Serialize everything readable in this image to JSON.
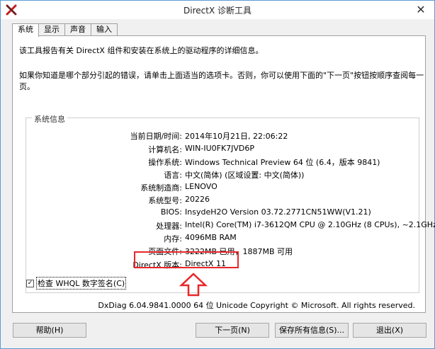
{
  "window": {
    "title": "DirectX 诊断工具"
  },
  "icons": {
    "app": "directx-x-icon",
    "close": "close-icon",
    "arrow": "up-arrow-icon",
    "check": "checkmark-icon"
  },
  "colors": {
    "highlight": "#e8262a",
    "window_border": "#5a9bd5"
  },
  "tabs": [
    {
      "label": "系统",
      "active": true
    },
    {
      "label": "显示",
      "active": false
    },
    {
      "label": "声音",
      "active": false
    },
    {
      "label": "输入",
      "active": false
    }
  ],
  "description": {
    "line1": "该工具报告有关 DirectX 组件和安装在系统上的驱动程序的详细信息。",
    "line2": "如果你知道是哪个部分引起的错误，请单击上面适当的选项卡。否则，你可以使用下面的\"下一页\"按钮按顺序查阅每一页。"
  },
  "system_info": {
    "group_label": "系统信息",
    "rows": [
      {
        "label": "当前日期/时间:",
        "value": "2014年10月21日, 22:06:22"
      },
      {
        "label": "计算机名:",
        "value": "WIN-IU0FK7JVD6P"
      },
      {
        "label": "操作系统:",
        "value": "Windows Technical Preview 64 位 (6.4，版本 9841)"
      },
      {
        "label": "语言:",
        "value": "中文(简体) (区域设置: 中文(简体))"
      },
      {
        "label": "系统制造商:",
        "value": "LENOVO"
      },
      {
        "label": "系统型号:",
        "value": "20226"
      },
      {
        "label": "BIOS:",
        "value": "InsydeH2O Version 03.72.2771CN51WW(V1.21)"
      },
      {
        "label": "处理器:",
        "value": "Intel(R) Core(TM) i7-3612QM CPU @ 2.10GHz (8 CPUs), ~2.1GHz"
      },
      {
        "label": "内存:",
        "value": "4096MB RAM"
      },
      {
        "label": "页面文件:",
        "value": "3222MB 已用，1887MB 可用"
      },
      {
        "label": "DirectX 版本:",
        "value": "DirectX 11"
      }
    ]
  },
  "whql": {
    "label": "检查 WHQL 数字签名(C)",
    "checked": true
  },
  "copyright": "DxDiag 6.04.9841.0000 64 位 Unicode  Copyright © Microsoft. All rights reserved.",
  "buttons": {
    "help": "帮助(H)",
    "next": "下一页(N)",
    "save": "保存所有信息(S)...",
    "exit": "退出(X)"
  }
}
